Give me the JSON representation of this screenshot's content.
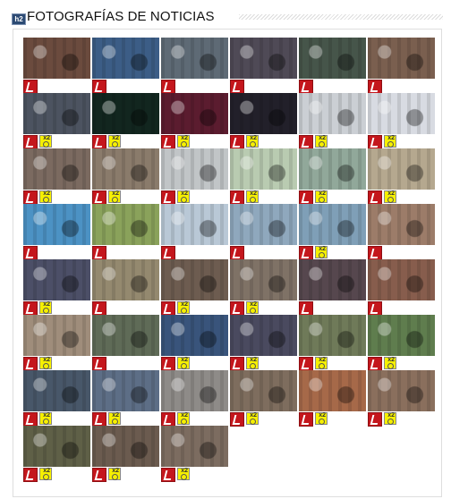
{
  "header": {
    "icon_label": "h2",
    "title": "FOTOGRAFÍAS DE NOTICIAS"
  },
  "gallery": {
    "zoom_badge": "x2",
    "photos": [
      {
        "bg": "#6b4b3e",
        "download": true,
        "zoom": false
      },
      {
        "bg": "#3c5d86",
        "download": true,
        "zoom": false
      },
      {
        "bg": "#5e6a75",
        "download": true,
        "zoom": false
      },
      {
        "bg": "#4f4a56",
        "download": true,
        "zoom": false
      },
      {
        "bg": "#46554a",
        "download": true,
        "zoom": false
      },
      {
        "bg": "#7a5f4f",
        "download": true,
        "zoom": false
      },
      {
        "bg": "#4c5360",
        "download": true,
        "zoom": true
      },
      {
        "bg": "#12261f",
        "download": true,
        "zoom": true
      },
      {
        "bg": "#5b1c2f",
        "download": true,
        "zoom": true
      },
      {
        "bg": "#22202a",
        "download": true,
        "zoom": true
      },
      {
        "bg": "#cbcfd4",
        "download": true,
        "zoom": true
      },
      {
        "bg": "#d8dbe2",
        "download": true,
        "zoom": true
      },
      {
        "bg": "#7b6a60",
        "download": true,
        "zoom": true
      },
      {
        "bg": "#8a7b6b",
        "download": true,
        "zoom": true
      },
      {
        "bg": "#c1c5c7",
        "download": true,
        "zoom": true
      },
      {
        "bg": "#b9cbb1",
        "download": true,
        "zoom": true
      },
      {
        "bg": "#91a89a",
        "download": true,
        "zoom": true
      },
      {
        "bg": "#b5a88f",
        "download": true,
        "zoom": true
      },
      {
        "bg": "#4c92c4",
        "download": true,
        "zoom": false
      },
      {
        "bg": "#8aa25b",
        "download": true,
        "zoom": false
      },
      {
        "bg": "#b9c8d6",
        "download": true,
        "zoom": false
      },
      {
        "bg": "#8fa8bd",
        "download": true,
        "zoom": false
      },
      {
        "bg": "#7f9fb7",
        "download": true,
        "zoom": true
      },
      {
        "bg": "#9c7c69",
        "download": true,
        "zoom": false
      },
      {
        "bg": "#4c4f67",
        "download": true,
        "zoom": true
      },
      {
        "bg": "#94896f",
        "download": true,
        "zoom": false
      },
      {
        "bg": "#6d5c50",
        "download": true,
        "zoom": true
      },
      {
        "bg": "#7f7266",
        "download": true,
        "zoom": true
      },
      {
        "bg": "#56474e",
        "download": true,
        "zoom": false
      },
      {
        "bg": "#875d4d",
        "download": true,
        "zoom": false
      },
      {
        "bg": "#9f8d7b",
        "download": true,
        "zoom": true
      },
      {
        "bg": "#5f6b57",
        "download": true,
        "zoom": false
      },
      {
        "bg": "#39547b",
        "download": true,
        "zoom": true
      },
      {
        "bg": "#4a4a5f",
        "download": true,
        "zoom": true
      },
      {
        "bg": "#6f7a59",
        "download": true,
        "zoom": true
      },
      {
        "bg": "#5f7d4e",
        "download": true,
        "zoom": true
      },
      {
        "bg": "#485769",
        "download": true,
        "zoom": true
      },
      {
        "bg": "#5d6e86",
        "download": true,
        "zoom": true
      },
      {
        "bg": "#8e8b88",
        "download": true,
        "zoom": true
      },
      {
        "bg": "#7e6d5e",
        "download": true,
        "zoom": true
      },
      {
        "bg": "#a66949",
        "download": true,
        "zoom": true
      },
      {
        "bg": "#8a6f5d",
        "download": true,
        "zoom": true
      },
      {
        "bg": "#5f6047",
        "download": true,
        "zoom": true
      },
      {
        "bg": "#6b5b4f",
        "download": true,
        "zoom": true
      },
      {
        "bg": "#7c6c60",
        "download": true,
        "zoom": true
      }
    ]
  }
}
